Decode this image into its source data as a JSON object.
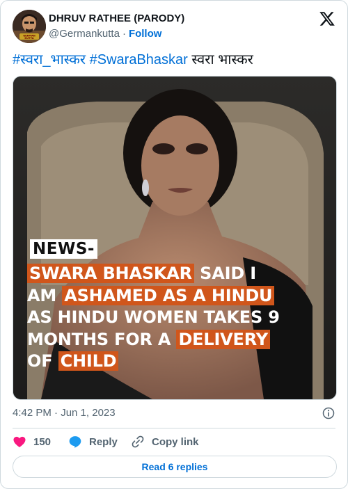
{
  "author": {
    "display_name": "DHRUV RATHEE (PARODY)",
    "handle": "@Germankutta",
    "separator": "·",
    "follow_label": "Follow",
    "avatar_badge_text": "GERMAN KUTTA"
  },
  "platform": {
    "logo_icon": "x-logo-icon"
  },
  "tweet": {
    "hashtag_1": "#स्वरा_भास्कर",
    "hashtag_2": "#SwaraBhaskar",
    "plain_text": "स्वरा भास्कर"
  },
  "media": {
    "news_label": "NEWS-",
    "headline": {
      "l1_highlight": "SWARA BHASKAR",
      "l1_rest": " SAID I",
      "l2_start": "AM ",
      "l2_highlight": "ASHAMED AS A HINDU",
      "l3": "AS HINDU WOMEN TAKES 9",
      "l4_start": "MONTHS FOR A ",
      "l4_highlight": "DELIVERY",
      "l5_start": "OF ",
      "l5_highlight": "CHILD"
    },
    "highlight_color": "#d0561b"
  },
  "timestamp": "4:42 PM · Jun 1, 2023",
  "actions": {
    "like_count": "150",
    "reply_label": "Reply",
    "copy_label": "Copy link"
  },
  "replies_button": "Read 6 replies",
  "colors": {
    "accent": "#006fd6",
    "like": "#f91880",
    "muted": "#536471",
    "border": "#cfd9de"
  }
}
